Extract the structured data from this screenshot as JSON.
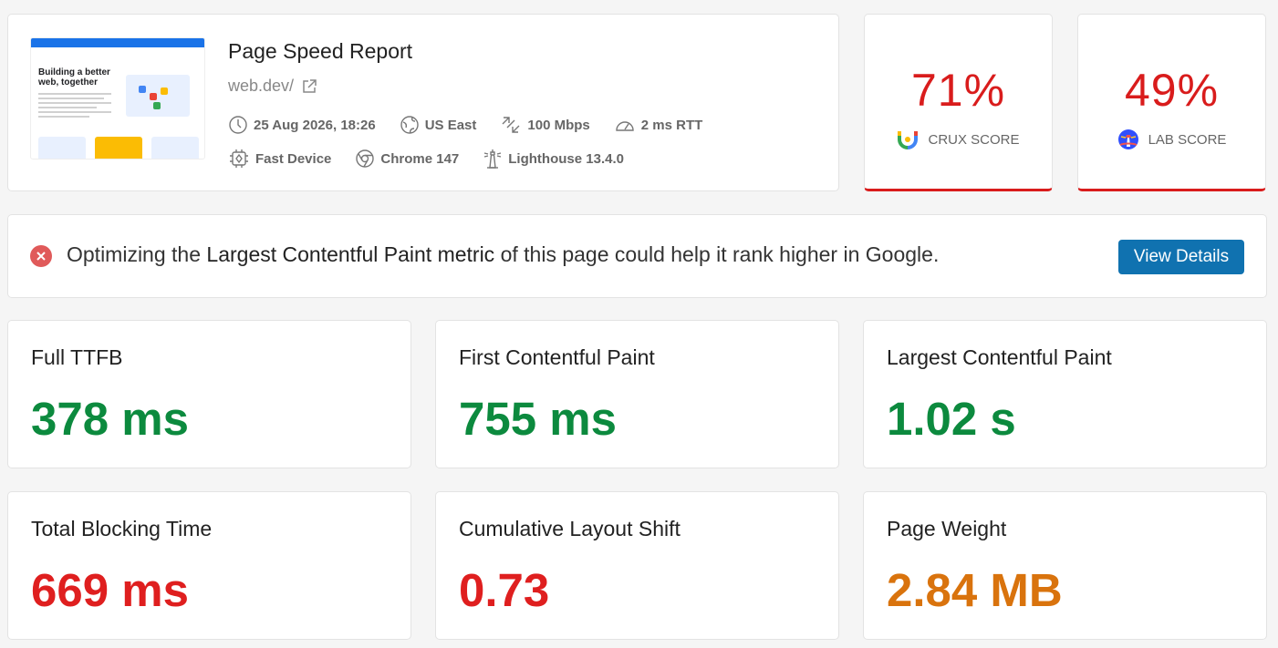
{
  "header": {
    "title": "Page Speed Report",
    "url": "web.dev/",
    "thumbnail_headline": "Building a better web, together",
    "meta": {
      "date": "25 Aug 2026, 18:26",
      "location": "US East",
      "bandwidth": "100 Mbps",
      "rtt": "2 ms RTT",
      "device": "Fast Device",
      "browser": "Chrome 147",
      "lighthouse": "Lighthouse 13.4.0"
    }
  },
  "scores": {
    "crux": {
      "value": "71%",
      "label": "CRUX SCORE"
    },
    "lab": {
      "value": "49%",
      "label": "LAB SCORE"
    }
  },
  "alert": {
    "prefix": "Optimizing the ",
    "emphasis": "Largest Contentful Paint metric",
    "suffix": " of this page could help it rank higher in Google.",
    "button_label": "View Details"
  },
  "metrics": [
    {
      "label": "Full TTFB",
      "value": "378 ms",
      "status": "good"
    },
    {
      "label": "First Contentful Paint",
      "value": "755 ms",
      "status": "good"
    },
    {
      "label": "Largest Contentful Paint",
      "value": "1.02 s",
      "status": "good"
    },
    {
      "label": "Total Blocking Time",
      "value": "669 ms",
      "status": "poor"
    },
    {
      "label": "Cumulative Layout Shift",
      "value": "0.73",
      "status": "poor"
    },
    {
      "label": "Page Weight",
      "value": "2.84 MB",
      "status": "needs-improvement"
    }
  ],
  "colors": {
    "good": "#0c8a3e",
    "poor": "#df1f1f",
    "needs_improvement": "#d9730d",
    "score_poor": "#d91c1c",
    "button": "#1072b0"
  },
  "icons": {
    "date": "clock-icon",
    "location": "globe-icon",
    "bandwidth": "network-arrows-icon",
    "rtt": "gauge-icon",
    "device": "cpu-chip-icon",
    "browser": "chrome-icon",
    "lighthouse": "lighthouse-icon",
    "url": "external-link-icon",
    "alert": "error-x-icon"
  }
}
